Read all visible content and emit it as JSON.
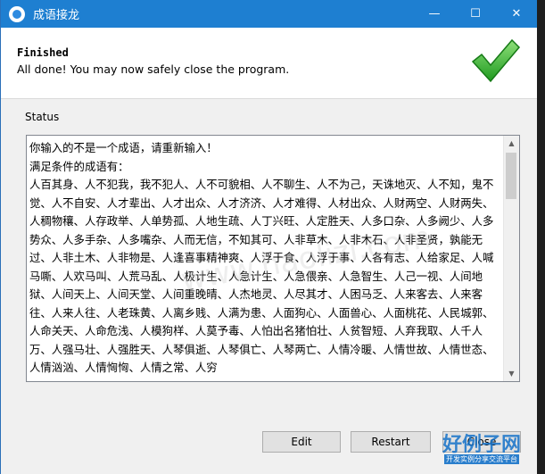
{
  "window": {
    "title": "成语接龙",
    "minimize_glyph": "—",
    "maximize_glyph": "☐",
    "close_glyph": "✕"
  },
  "header": {
    "title": "Finished",
    "subtitle": "All done! You may now safely close the program.",
    "icon": "checkmark-icon",
    "icon_color": "#2cab2c"
  },
  "status": {
    "label": "Status",
    "log_lines": [
      "你输入的不是一个成语，请重新输入！",
      "满足条件的成语有：",
      "人百其身、人不犯我，我不犯人、人不可貌相、人不聊生、人不为己，天诛地灭、人不知，鬼不觉、人不自安、人才辈出、人才出众、人才济济、人才难得、人材出众、人财两空、人财两失、人稠物穰、人存政举、人单势孤、人地生疏、人丁兴旺、人定胜天、人多口杂、人多阙少、人多势众、人多手杂、人多嘴杂、人而无信，不知其可、人非草木、人非木石、人非圣贤，孰能无过、人非土木、人非物是、人逢喜事精神爽、人浮于食、人浮于事、人各有志、人给家足、人喊马嘶、人欢马叫、人荒马乱、人极计生、人急计生、人急偎亲、人急智生、人己一视、人间地狱、人间天上、人间天堂、人间重晚晴、人杰地灵、人尽其才、人困马乏、人来客去、人来客往、人来人往、人老珠黄、人离乡贱、人满为患、人面狗心、人面兽心、人面桃花、人民城郭、人命关天、人命危浅、人模狗样、人莫予毒、人怕出名猪怕壮、人贫智短、人弃我取、人千人万、人强马壮、人强胜天、人琴俱逝、人琴俱亡、人琴两亡、人情冷暖、人情世故、人情世态、人情汹汹、人情恟恟、人情之常、人穷"
    ]
  },
  "buttons": {
    "edit": "Edit",
    "restart": "Restart",
    "close": "Close"
  },
  "watermark": {
    "center": "www.haolizi.com",
    "logo": "好例子网",
    "sub": "开发实例分享交流平台"
  }
}
